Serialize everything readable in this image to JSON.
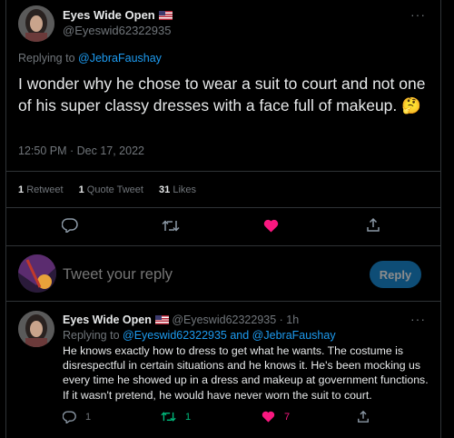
{
  "main_tweet": {
    "author_name": "Eyes Wide Open",
    "author_handle": "@Eyeswid62322935",
    "replying_prefix": "Replying to",
    "replying_to": "@JebraFaushay",
    "text": "I wonder why he chose to wear a suit to court and not one of his super classy dresses with a face full of makeup. 🤔",
    "timestamp": "12:50 PM · Dec 17, 2022",
    "stats": {
      "retweets_count": "1",
      "retweets_label": "Retweet",
      "quotes_count": "1",
      "quotes_label": "Quote Tweet",
      "likes_count": "31",
      "likes_label": "Likes"
    },
    "more_label": "···"
  },
  "composer": {
    "placeholder": "Tweet your reply",
    "reply_button": "Reply"
  },
  "reply_tweet": {
    "author_name": "Eyes Wide Open",
    "author_handle": "@Eyeswid62322935",
    "time": "· 1h",
    "replying_prefix": "Replying to",
    "replying_to": "@Eyeswid62322935 and @JebraFaushay",
    "text": "He knows exactly how to dress to get what he wants. The costume is disrespectful in certain situations and he knows it. He's been mocking us every time he showed up in a dress and makeup at government functions. If it wasn't pretend, he would have never worn the suit to court.",
    "counts": {
      "replies": "1",
      "retweets": "1",
      "likes": "7"
    },
    "more_label": "···"
  },
  "colors": {
    "accent": "#1d9bf0",
    "like": "#f91880",
    "retweet": "#00ba7c",
    "reply_button": "#1a8cd8"
  },
  "icons": [
    "reply-icon",
    "retweet-icon",
    "like-icon",
    "share-icon",
    "more-icon",
    "us-flag-icon"
  ]
}
